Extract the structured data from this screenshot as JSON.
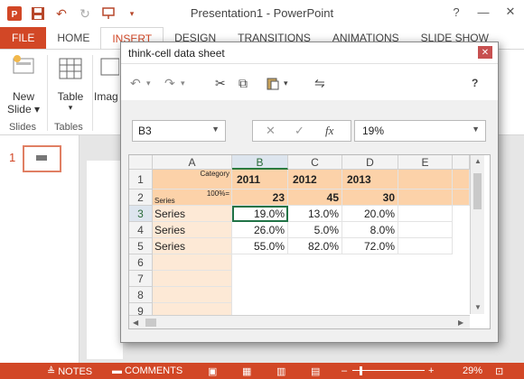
{
  "app": {
    "title": "Presentation1 - PowerPoint",
    "accent": "#d24726"
  },
  "qat": {
    "icons": [
      "powerpoint-logo-icon",
      "save-icon",
      "undo-icon",
      "redo-icon",
      "slideshow-icon"
    ]
  },
  "window_controls": {
    "help": "?",
    "minimize": "—",
    "close": "✕"
  },
  "tabs": [
    {
      "label": "FILE"
    },
    {
      "label": "HOME"
    },
    {
      "label": "INSERT"
    },
    {
      "label": "DESIGN"
    },
    {
      "label": "TRANSITIONS"
    },
    {
      "label": "ANIMATIONS"
    },
    {
      "label": "SLIDE SHOW"
    }
  ],
  "ribbon": {
    "new_slide": {
      "line1": "New",
      "line2": "Slide"
    },
    "table": "Table",
    "images": "Imag",
    "groups": {
      "slides": "Slides",
      "tables": "Tables"
    }
  },
  "thumbnails": {
    "slide_number": "1"
  },
  "status": {
    "notes": "NOTES",
    "comments": "COMMENTS",
    "zoom": "29%"
  },
  "dialog": {
    "title": "think-cell data sheet",
    "close": "✕",
    "help": "?",
    "cell_ref": "B3",
    "formula_value": "19%",
    "fx": "fx",
    "columns": [
      "A",
      "B",
      "C",
      "D",
      "E"
    ],
    "rows": [
      "1",
      "2",
      "3",
      "4",
      "5",
      "6",
      "7",
      "8",
      "9"
    ],
    "header_row": {
      "a_label": "Category",
      "years": [
        "2011",
        "2012",
        "2013"
      ]
    },
    "totals_row": {
      "a_top": "100%=",
      "a_bottom": "Series",
      "values": [
        "23",
        "45",
        "30"
      ]
    },
    "data_rows": [
      {
        "label": "Series",
        "values": [
          "19.0%",
          "13.0%",
          "20.0%"
        ]
      },
      {
        "label": "Series",
        "values": [
          "26.0%",
          "5.0%",
          "8.0%"
        ]
      },
      {
        "label": "Series",
        "values": [
          "55.0%",
          "82.0%",
          "72.0%"
        ]
      }
    ]
  }
}
